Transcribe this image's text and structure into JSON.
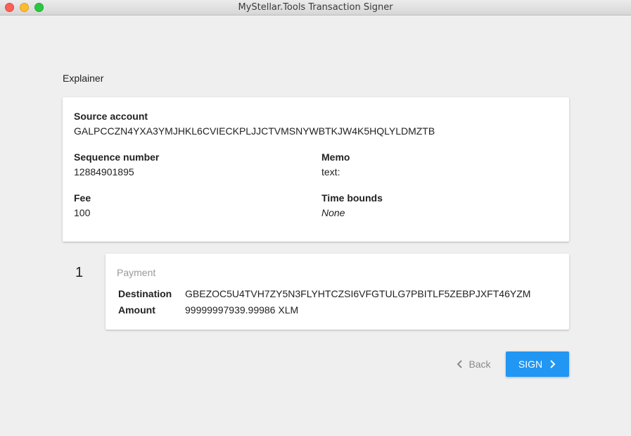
{
  "window": {
    "title": "MyStellar.Tools Transaction Signer"
  },
  "section_title": "Explainer",
  "summary": {
    "source_account_label": "Source account",
    "source_account": "GALPCCZN4YXA3YMJHKL6CVIECKPLJJCTVMSNYWBTKJW4K5HQLYLDMZTB",
    "sequence_label": "Sequence number",
    "sequence": "12884901895",
    "memo_label": "Memo",
    "memo": "text:",
    "fee_label": "Fee",
    "fee": "100",
    "time_bounds_label": "Time bounds",
    "time_bounds": "None"
  },
  "operations": [
    {
      "index": "1",
      "type": "Payment",
      "destination_label": "Destination",
      "destination": "GBEZOC5U4TVH7ZY5N3FLYHTCZSI6VFGTULG7PBITLF5ZEBPJXFT46YZM",
      "amount_label": "Amount",
      "amount": "99999997939.99986 XLM"
    }
  ],
  "actions": {
    "back_label": "Back",
    "sign_label": "SIGN"
  },
  "colors": {
    "accent": "#2196f3",
    "background": "#efefef"
  },
  "icons": {
    "back": "chevron-left-icon",
    "sign": "chevron-right-icon"
  }
}
